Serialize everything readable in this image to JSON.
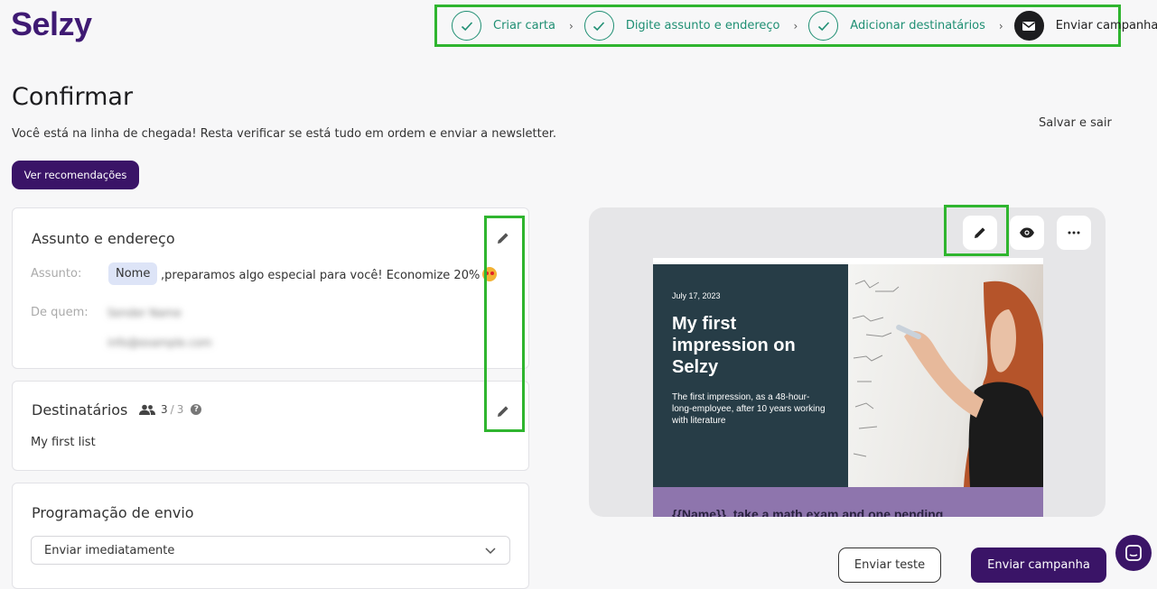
{
  "brand": {
    "logo_text": "Selzy",
    "accent": "#3a1467",
    "highlight": "#2fb52f"
  },
  "stepper": {
    "steps": [
      {
        "label": "Criar carta",
        "icon": "check-icon",
        "done": true
      },
      {
        "label": "Digite assunto e endereço",
        "icon": "check-icon",
        "done": true
      },
      {
        "label": "Adicionar destinatários",
        "icon": "check-icon",
        "done": true
      },
      {
        "label": "Enviar campanha",
        "icon": "envelope-icon",
        "done": false
      }
    ]
  },
  "header": {
    "title": "Confirmar",
    "subtitle": "Você está na linha de chegada! Resta verificar se está tudo em ordem e enviar a newsletter.",
    "save_exit": "Salvar e sair",
    "recommendations_button": "Ver recomendações"
  },
  "subject_card": {
    "title": "Assunto e endereço",
    "subject_label": "Assunto:",
    "subject_tag": "Nome",
    "subject_text": ",preparamos algo especial para você! Economize 20%",
    "from_label": "De quem:",
    "from_name": "Sender Name",
    "from_email": "info@example.com"
  },
  "recipients_card": {
    "title": "Destinatários",
    "count": "3",
    "total": "3",
    "list_name": "My first list"
  },
  "schedule_card": {
    "title": "Programação de envio",
    "selected": "Enviar imediatamente"
  },
  "preview": {
    "date": "July 17, 2023",
    "headline": "My first impression on Selzy",
    "description": "The first impression, as a 48-hour-long-employee, after 10 years working with literature",
    "band_text": "{{Name}}, take a math exam and one pending"
  },
  "footer": {
    "test_button": "Enviar teste",
    "send_button": "Enviar campanha"
  }
}
